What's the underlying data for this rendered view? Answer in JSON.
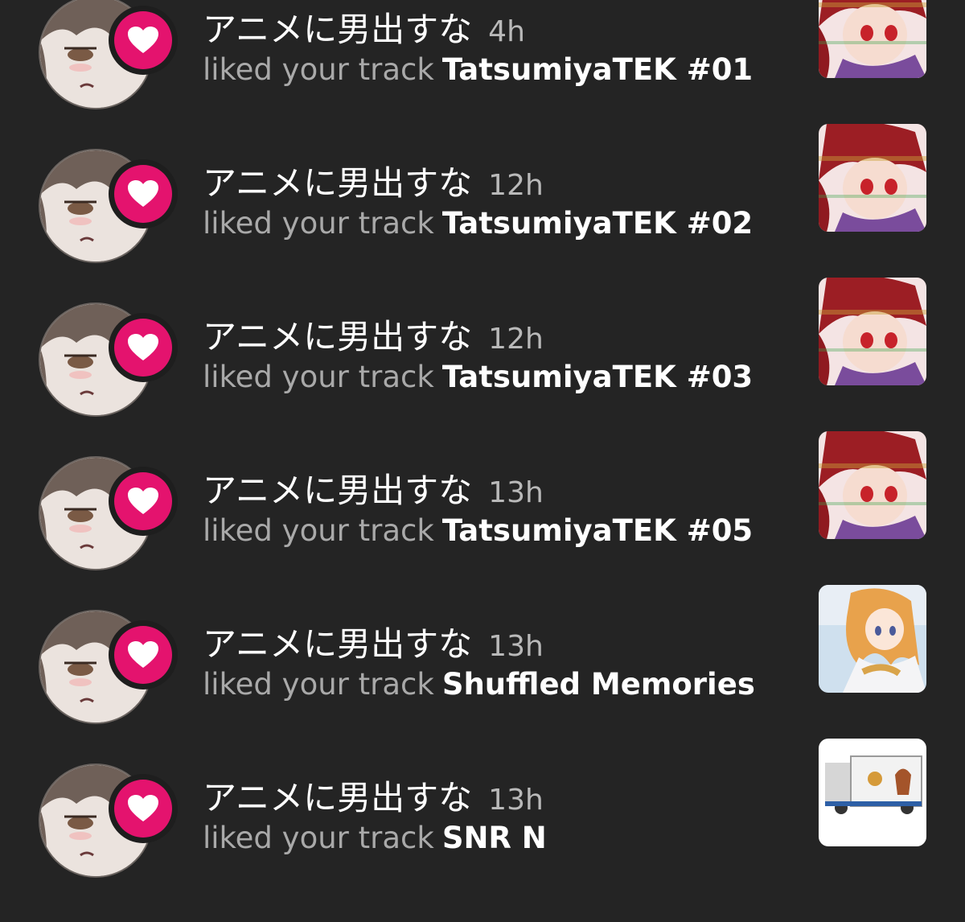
{
  "feed": {
    "items": [
      {
        "user": "アニメに男出すな",
        "time": "4h",
        "action": "liked your track",
        "track": "TatsumiyaTEK #01",
        "artwork": "tatsumiya-art"
      },
      {
        "user": "アニメに男出すな",
        "time": "12h",
        "action": "liked your track",
        "track": "TatsumiyaTEK #02",
        "artwork": "tatsumiya-art"
      },
      {
        "user": "アニメに男出すな",
        "time": "12h",
        "action": "liked your track",
        "track": "TatsumiyaTEK #03",
        "artwork": "tatsumiya-art"
      },
      {
        "user": "アニメに男出すな",
        "time": "13h",
        "action": "liked your track",
        "track": "TatsumiyaTEK #05",
        "artwork": "tatsumiya-art"
      },
      {
        "user": "アニメに男出すな",
        "time": "13h",
        "action": "liked your track",
        "track": "Shuffled Memories",
        "artwork": "shuffled-memories-art"
      },
      {
        "user": "アニメに男出すな",
        "time": "13h",
        "action": "liked your track",
        "track": "SNR N",
        "artwork": "truck-art"
      }
    ]
  },
  "colors": {
    "background": "#242424",
    "heart_badge": "#e4136e",
    "primary_text": "#ffffff",
    "secondary_text": "#a9a9a9"
  }
}
